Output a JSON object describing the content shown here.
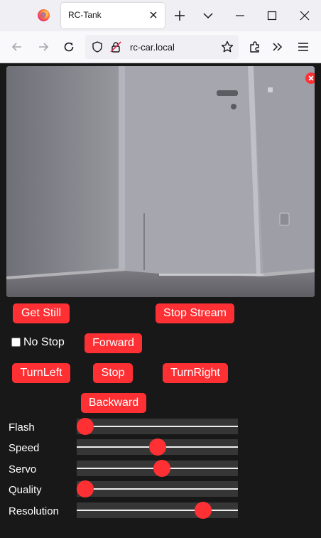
{
  "browser": {
    "tab_title": "RC-Tank",
    "url": "rc-car.local",
    "icons": [
      "firefox-logo",
      "tab-close-icon",
      "new-tab-icon",
      "tab-list-icon",
      "minimize-icon",
      "maximize-icon",
      "window-close-icon",
      "back-icon",
      "forward-icon",
      "reload-icon",
      "shield-icon",
      "lock-icon",
      "star-icon",
      "extensions-icon",
      "overflow-icon",
      "menu-icon"
    ]
  },
  "stream": {
    "close_icon": "close-icon"
  },
  "controls": {
    "get_still": "Get Still",
    "stop_stream": "Stop Stream",
    "no_stop_label": "No Stop",
    "no_stop_checked": false,
    "forward": "Forward",
    "turn_left": "TurnLeft",
    "stop": "Stop",
    "turn_right": "TurnRight",
    "backward": "Backward"
  },
  "sliders": [
    {
      "label": "Flash",
      "value": 0
    },
    {
      "label": "Speed",
      "value": 0.5
    },
    {
      "label": "Servo",
      "value": 0.53
    },
    {
      "label": "Quality",
      "value": 0
    },
    {
      "label": "Resolution",
      "value": 0.82
    }
  ],
  "colors": {
    "accent": "#ff3034",
    "page_background": "#181818",
    "slider_track": "#363636"
  }
}
